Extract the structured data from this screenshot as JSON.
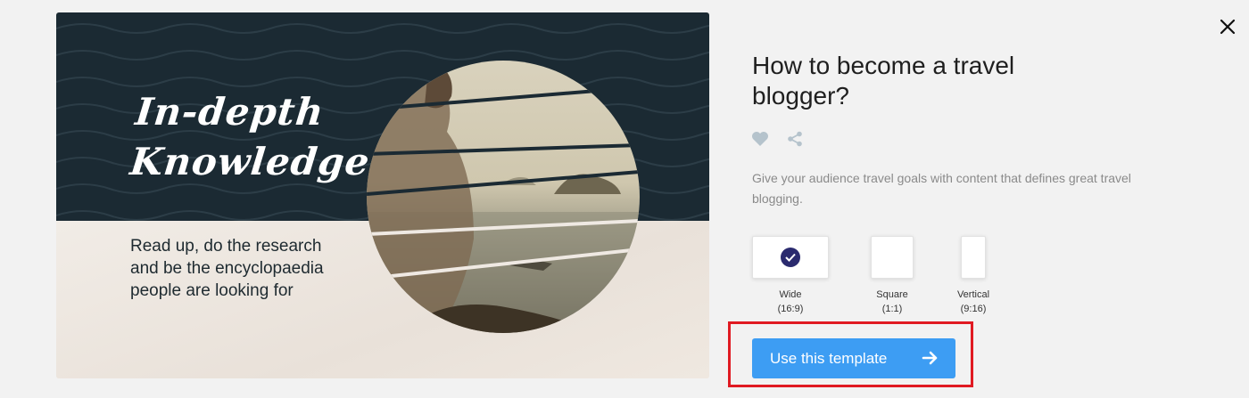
{
  "template": {
    "title": "How to become a travel blogger?",
    "description": "Give your audience travel goals with content that defines great travel blogging."
  },
  "preview": {
    "headline": "In-depth Knowledge",
    "body": "Read up, do the research and be the encyclopaedia people are looking for"
  },
  "actions": {
    "like_icon": "heart-icon",
    "share_icon": "share-icon",
    "close_icon": "close-icon"
  },
  "formats": [
    {
      "name": "Wide",
      "ratio": "(16:9)",
      "selected": true
    },
    {
      "name": "Square",
      "ratio": "(1:1)",
      "selected": false
    },
    {
      "name": "Vertical",
      "ratio": "(9:16)",
      "selected": false
    }
  ],
  "cta": {
    "label": "Use this template",
    "icon": "arrow-right-icon"
  },
  "colors": {
    "accent": "#3d9df3",
    "check": "#2a2a6e",
    "highlight": "#e01a22",
    "preview_dark": "#1b2a33"
  }
}
